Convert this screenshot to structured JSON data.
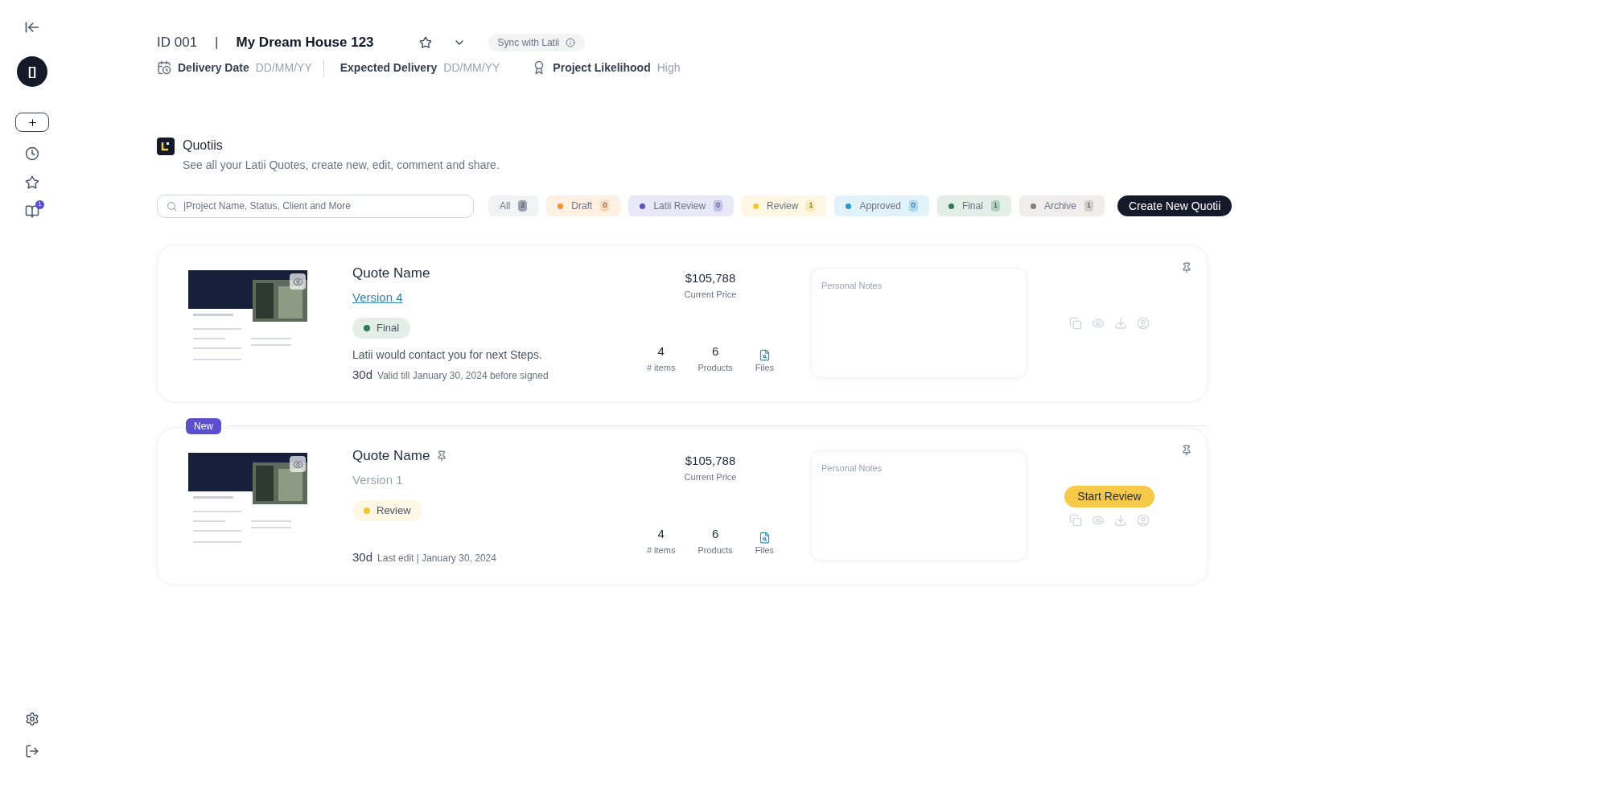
{
  "sidebar": {
    "logo": "[]",
    "badge": "1"
  },
  "header": {
    "id": "ID 001",
    "separator": "|",
    "project_name": "My Dream House 123",
    "sync_button": "Sync with Latii",
    "fields": [
      {
        "kind": "date",
        "label": "Delivery Date",
        "value": "DD/MM/YY"
      },
      {
        "kind": "plain",
        "label": "Expected Delivery",
        "value": "DD/MM/YY"
      },
      {
        "kind": "award",
        "label": "Project Likelihood",
        "value": "High"
      }
    ]
  },
  "section": {
    "title": "Quotiis",
    "subtitle": "See all your Latii Quotes, create new, edit, comment and share."
  },
  "search": {
    "placeholder": "|Project Name, Status, Client and More"
  },
  "filters": [
    {
      "label": "All",
      "count": "2",
      "color": "#9ca3af"
    },
    {
      "label": "Draft",
      "count": "0",
      "color": "#f5922f"
    },
    {
      "label": "Latii Review",
      "count": "0",
      "color": "#5b4fcf"
    },
    {
      "label": "Review",
      "count": "1",
      "color": "#f5c431"
    },
    {
      "label": "Approved",
      "count": "0",
      "color": "#1e9bd7"
    },
    {
      "label": "Final",
      "count": "1",
      "color": "#2e7d5b"
    },
    {
      "label": "Archive",
      "count": "1",
      "color": "#8a7d72"
    }
  ],
  "create_button": "Create New Quotii",
  "quotes": [
    {
      "name": "Quote Name",
      "name_pinned": false,
      "version": "Version 4",
      "version_current": true,
      "status": {
        "label": "Final",
        "color": "#2e7d5b"
      },
      "message": "Latii would contact you for next Steps.",
      "days": "30d",
      "date_note": "Valid till January 30, 2024 before signed",
      "price": "$105,788",
      "price_label": "Current Price",
      "stats": [
        {
          "value": "4",
          "label": "# items"
        },
        {
          "value": "6",
          "label": "Products"
        }
      ],
      "files_label": "Files",
      "notes_placeholder": "Personal Notes"
    },
    {
      "badge": "New",
      "name": "Quote Name",
      "name_pinned": true,
      "version": "Version 1",
      "version_current": false,
      "status": {
        "label": "Review",
        "color": "#f5c431"
      },
      "days": "30d",
      "date_note": "Last edit | January 30, 2024",
      "price": "$105,788",
      "price_label": "Current Price",
      "stats": [
        {
          "value": "4",
          "label": "# items"
        },
        {
          "value": "6",
          "label": "Products"
        }
      ],
      "files_label": "Files",
      "notes_placeholder": "Personal Notes",
      "action_button": "Start Review"
    }
  ]
}
